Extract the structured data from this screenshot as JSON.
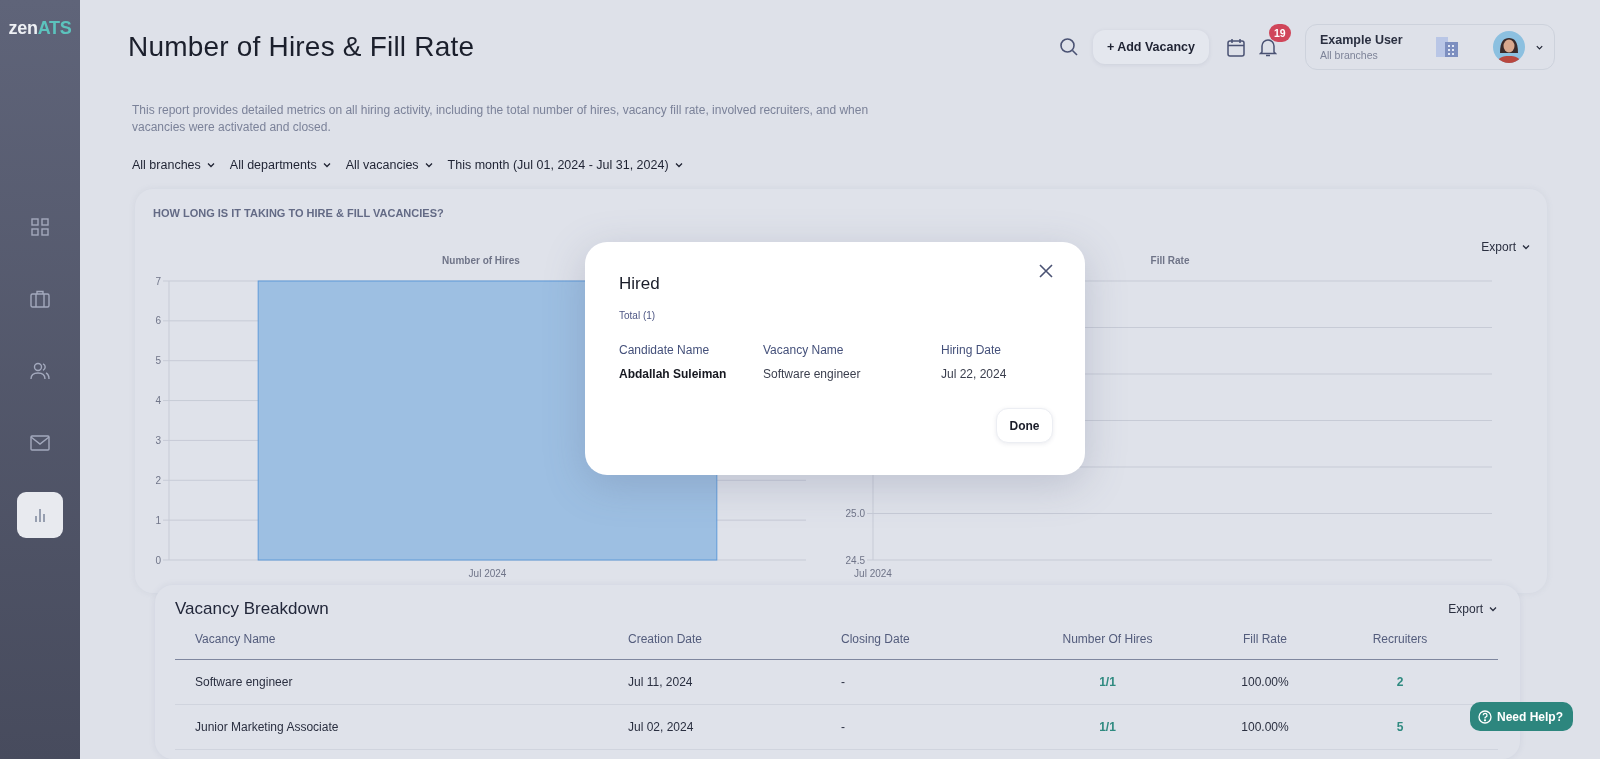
{
  "logo": {
    "text": "zen",
    "accent": "ATS"
  },
  "sidebar": {
    "items": [
      {
        "kind": "grid",
        "selected": false
      },
      {
        "kind": "briefcase",
        "selected": false
      },
      {
        "kind": "people",
        "selected": false
      },
      {
        "kind": "mail",
        "selected": false
      },
      {
        "kind": "chart",
        "selected": true
      }
    ]
  },
  "header": {
    "title": "Number of Hires & Fill Rate",
    "add_button": "+ Add Vacancy",
    "notification_count": "19",
    "user": {
      "name": "Example User",
      "branch": "All branches"
    }
  },
  "description": "This report provides detailed metrics on all hiring activity, including the total number of hires, vacancy fill rate, involved recruiters, and when vacancies were activated and closed.",
  "filters": [
    "All branches",
    "All departments",
    "All vacancies",
    "This month (Jul 01, 2024 - Jul 31, 2024)"
  ],
  "charts_card": {
    "title": "HOW LONG IS IT TAKING TO HIRE & FILL VACANCIES?",
    "export": "Export",
    "hires_chart": {
      "title": "Number of Hires",
      "chart_data": {
        "type": "bar",
        "categories": [
          "Jul 2024"
        ],
        "values": [
          7
        ],
        "ylim": [
          0,
          7
        ],
        "yticks": [
          0,
          1,
          2,
          3,
          4,
          5,
          6,
          7
        ],
        "grid": true
      }
    },
    "fill_rate_chart": {
      "title": "Fill Rate",
      "chart_data": {
        "type": "line",
        "categories": [
          "Jul 2024"
        ],
        "values": [
          null
        ],
        "ylim": [
          24.5,
          27.5
        ],
        "yticks": [
          24.5,
          {
            "value": 25.0,
            "label": "25.0"
          }
        ],
        "grid": true
      }
    }
  },
  "table": {
    "title": "Vacancy Breakdown",
    "export": "Export",
    "columns": [
      "Vacancy Name",
      "Creation Date",
      "Closing Date",
      "Number Of Hires",
      "Fill Rate",
      "Recruiters"
    ],
    "rows": [
      [
        "Software engineer",
        "Jul 11, 2024",
        "-",
        "1/1",
        "100.00%",
        "2"
      ],
      [
        "Junior Marketing Associate",
        "Jul 02, 2024",
        "-",
        "1/1",
        "100.00%",
        "5"
      ]
    ]
  },
  "modal": {
    "title": "Hired",
    "total": "Total (1)",
    "columns": [
      "Candidate Name",
      "Vacancy Name",
      "Hiring Date"
    ],
    "rows": [
      [
        "Abdallah Suleiman",
        "Software engineer",
        "Jul 22, 2024"
      ]
    ],
    "done_button": "Done"
  },
  "help_button": "Need Help?"
}
